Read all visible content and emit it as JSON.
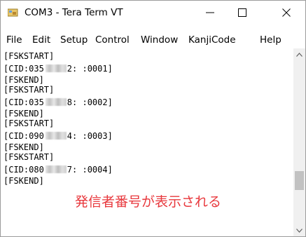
{
  "window": {
    "title": "COM3 - Tera Term VT",
    "minimize_symbol": "—",
    "maximize_symbol": "☐",
    "close_symbol": "✕"
  },
  "menu": {
    "items": [
      "File",
      "Edit",
      "Setup",
      "Control",
      "Window",
      "KanjiCode",
      "Help"
    ]
  },
  "terminal": {
    "lines": [
      {
        "text": "[FSKSTART]"
      },
      {
        "prefix": "[CID:035",
        "suffix": "2: :0001]",
        "redacted": true
      },
      {
        "text": "[FSKEND]"
      },
      {
        "text": "[FSKSTART]"
      },
      {
        "prefix": "[CID:035",
        "suffix": "8: :0002]",
        "redacted": true
      },
      {
        "text": "[FSKEND]"
      },
      {
        "text": "[FSKSTART]"
      },
      {
        "prefix": "[CID:090",
        "suffix": "4: :0003]",
        "redacted": true
      },
      {
        "text": "[FSKEND]"
      },
      {
        "text": "[FSKSTART]"
      },
      {
        "prefix": "[CID:080",
        "suffix": "7: :0004]",
        "redacted": true
      },
      {
        "text": "[FSKEND]"
      }
    ]
  },
  "annotation": "発信者番号が表示される",
  "colors": {
    "annotation": "#e8383d"
  },
  "icons": {
    "app": "tera-term-icon",
    "scroll_up": "chevron-up-icon",
    "scroll_down": "chevron-down-icon"
  }
}
